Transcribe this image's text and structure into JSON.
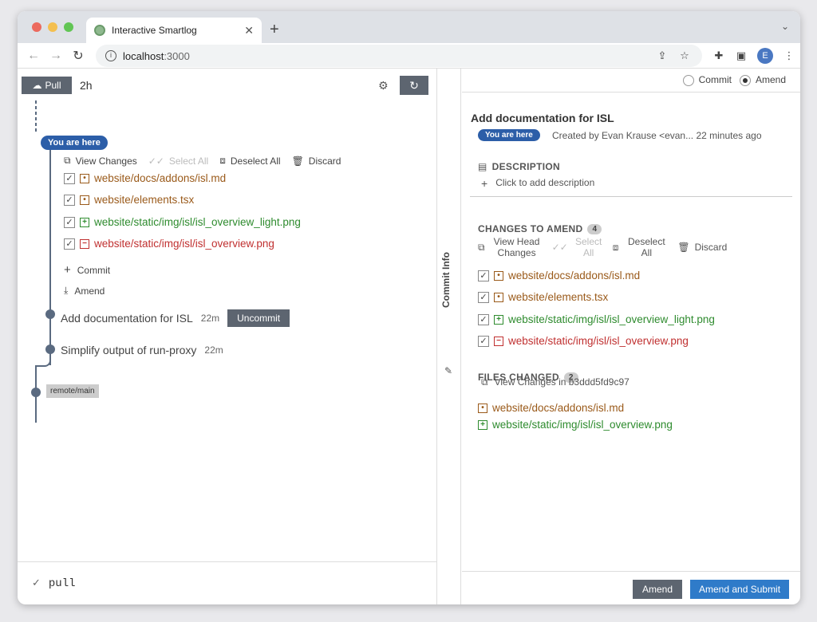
{
  "browser": {
    "tab_title": "Interactive Smartlog",
    "url_host": "localhost",
    "url_port": ":3000",
    "avatar_letter": "E"
  },
  "left": {
    "pull_label": "Pull",
    "fetch_age": "2h",
    "you_are_here": "You are here",
    "actions": {
      "view_changes": "View Changes",
      "select_all": "Select All",
      "deselect_all": "Deselect All",
      "discard": "Discard"
    },
    "files": [
      {
        "path": "website/docs/addons/isl.md",
        "status": "modified",
        "mark": "•"
      },
      {
        "path": "website/elements.tsx",
        "status": "modified",
        "mark": "•"
      },
      {
        "path": "website/static/img/isl/isl_overview_light.png",
        "status": "added",
        "mark": "+"
      },
      {
        "path": "website/static/img/isl/isl_overview.png",
        "status": "removed",
        "mark": "−"
      }
    ],
    "commit_label": "Commit",
    "amend_label": "Amend",
    "commits": [
      {
        "title": "Add documentation for ISL",
        "age": "22m",
        "button": "Uncommit"
      },
      {
        "title": "Simplify output of run-proxy",
        "age": "22m"
      }
    ],
    "remote_badge": "remote/main",
    "bottom_command": "pull"
  },
  "drawer": {
    "label": "Commit Info"
  },
  "right": {
    "mode_commit": "Commit",
    "mode_amend": "Amend",
    "title": "Add documentation for ISL",
    "you_are_here": "You are here",
    "created": "Created by Evan Krause <evan... 22 minutes ago",
    "description_head": "DESCRIPTION",
    "add_description": "Click to add description",
    "changes_head": "CHANGES TO AMEND",
    "changes_count": "4",
    "actions": {
      "view_head_changes": "View Head Changes",
      "select_all": "Select All",
      "deselect_all": "Deselect All",
      "discard": "Discard"
    },
    "changes": [
      {
        "path": "website/docs/addons/isl.md",
        "status": "modified",
        "mark": "•"
      },
      {
        "path": "website/elements.tsx",
        "status": "modified",
        "mark": "•"
      },
      {
        "path": "website/static/img/isl/isl_overview_light.png",
        "status": "added",
        "mark": "+"
      },
      {
        "path": "website/static/img/isl/isl_overview.png",
        "status": "removed",
        "mark": "−"
      }
    ],
    "files_changed_head": "FILES CHANGED",
    "files_changed_count": "2",
    "view_changes_in": "View Changes in b3ddd5fd9c97",
    "files_changed": [
      {
        "path": "website/docs/addons/isl.md",
        "status": "modified",
        "mark": "•"
      },
      {
        "path": "website/static/img/isl/isl_overview.png",
        "status": "added",
        "mark": "+"
      }
    ],
    "amend_button": "Amend",
    "amend_submit_button": "Amend and Submit"
  }
}
